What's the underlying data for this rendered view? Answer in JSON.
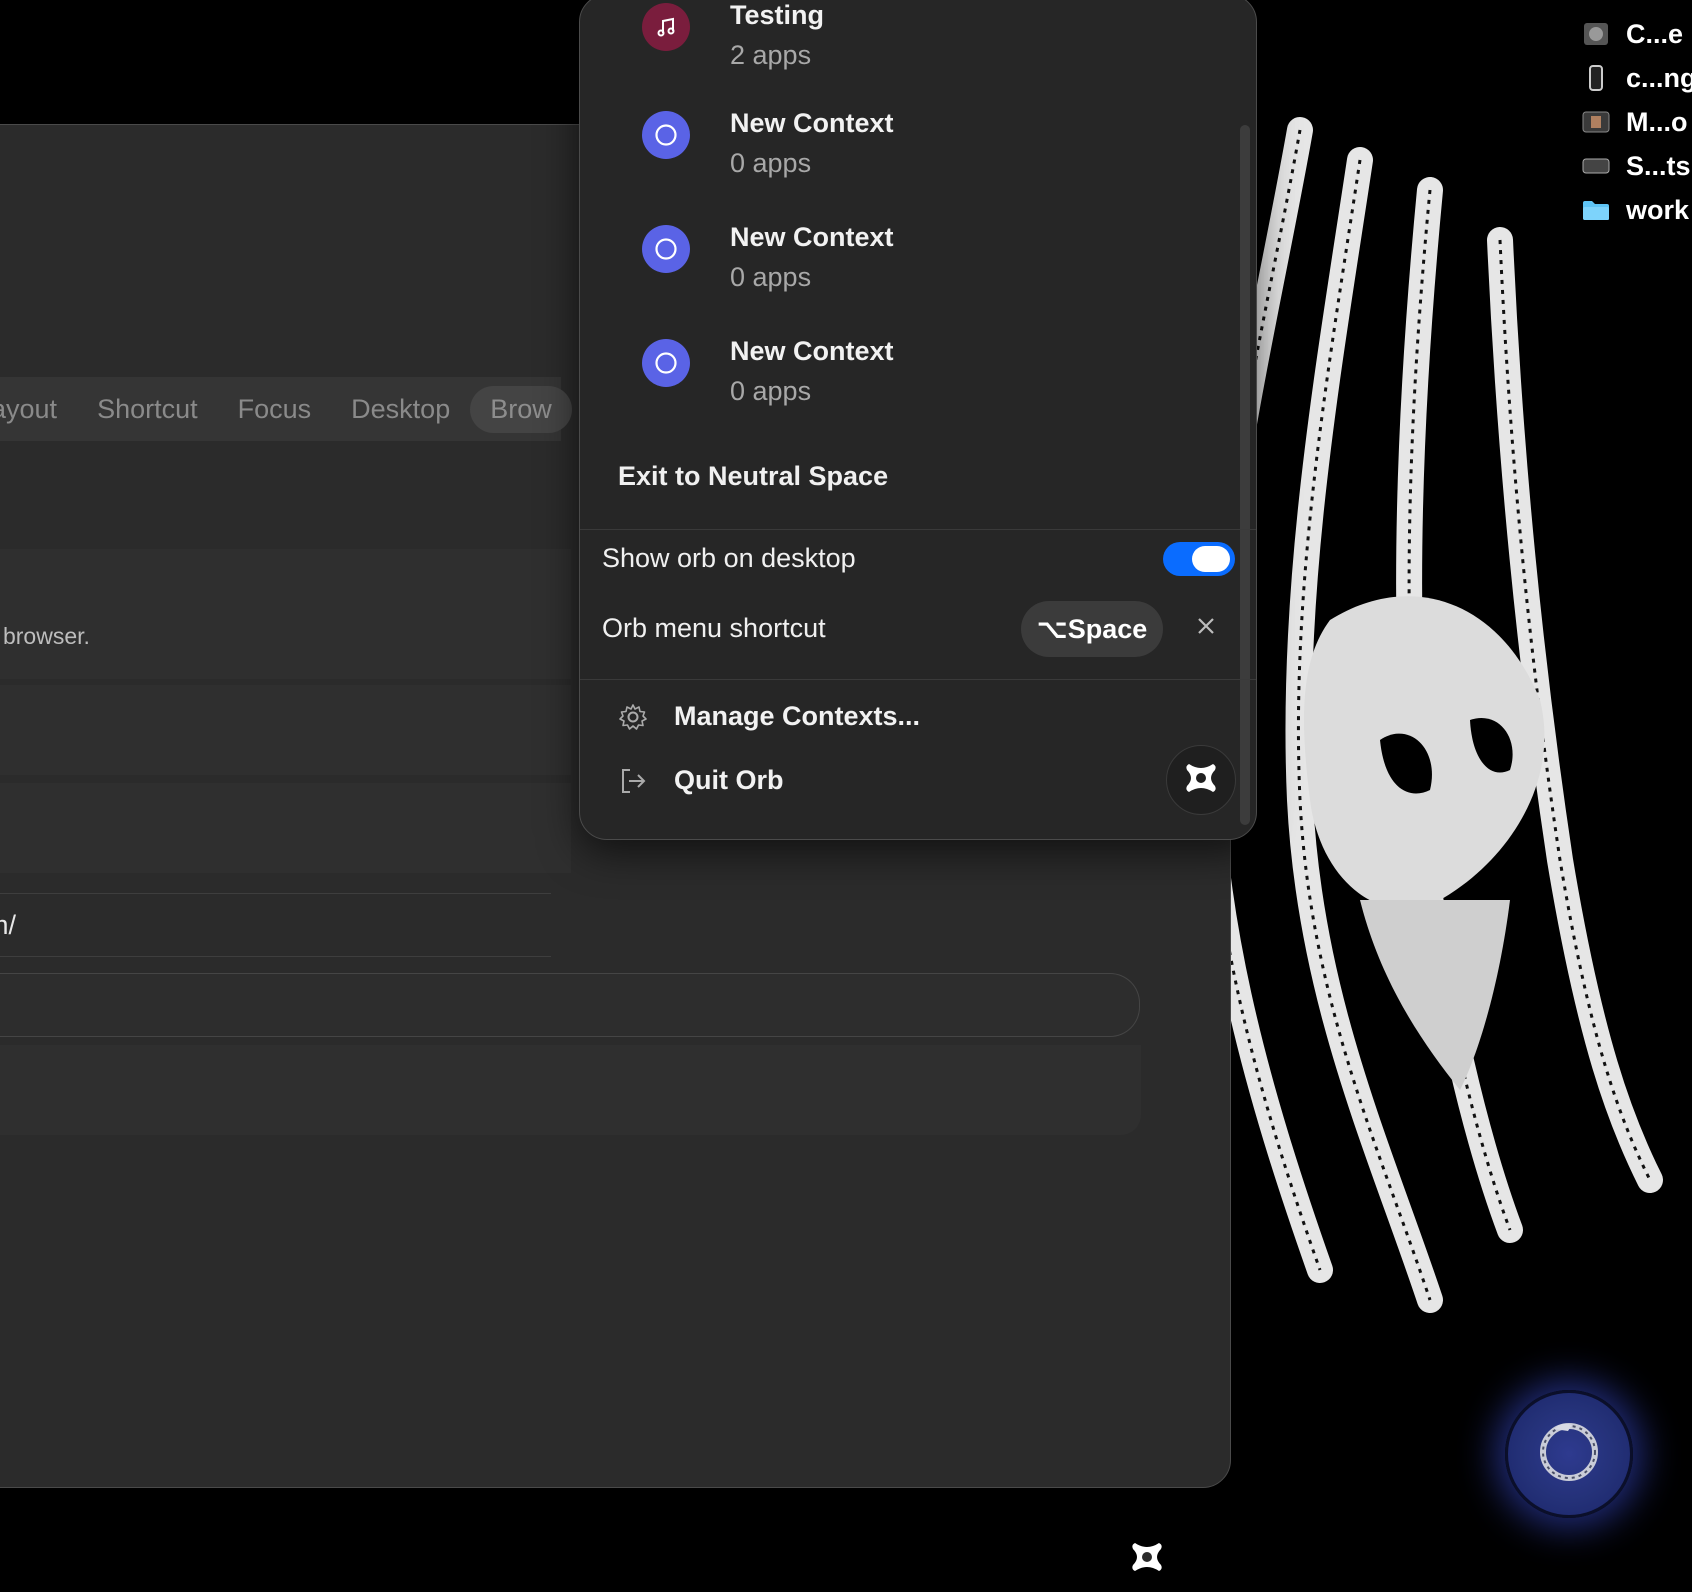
{
  "desktop": {
    "icons": [
      {
        "label": "C...e",
        "icon": "image-file-icon"
      },
      {
        "label": "c...ng",
        "icon": "phone-file-icon"
      },
      {
        "label": "M...o",
        "icon": "video-file-icon"
      },
      {
        "label": "S...ts",
        "icon": "screenshot-file-icon"
      },
      {
        "label": "work",
        "icon": "folder-icon"
      }
    ]
  },
  "settings_window": {
    "tabs": [
      "ayout",
      "Shortcut",
      "Focus",
      "Desktop",
      "Brow"
    ],
    "active_tab": "Brow",
    "helper_text": "en browser.",
    "url_value": "om/"
  },
  "orb_menu": {
    "contexts": [
      {
        "name": "Testing",
        "count": "2 apps",
        "icon": "music-note-icon",
        "color": "#7a1d3d"
      },
      {
        "name": "New Context",
        "count": "0 apps",
        "icon": "circle-icon",
        "color": "#5a63e6"
      },
      {
        "name": "New Context",
        "count": "0 apps",
        "icon": "circle-icon",
        "color": "#5a63e6"
      },
      {
        "name": "New Context",
        "count": "0 apps",
        "icon": "circle-icon",
        "color": "#5a63e6"
      }
    ],
    "exit_label": "Exit to Neutral Space",
    "show_orb_label": "Show orb on desktop",
    "show_orb_enabled": true,
    "shortcut_label": "Orb menu shortcut",
    "shortcut_value": "⌥Space",
    "manage_label": "Manage Contexts...",
    "quit_label": "Quit Orb"
  },
  "colors": {
    "toggle_on": "#0a6cff",
    "context_blue": "#5a63e6",
    "context_maroon": "#7a1d3d"
  }
}
